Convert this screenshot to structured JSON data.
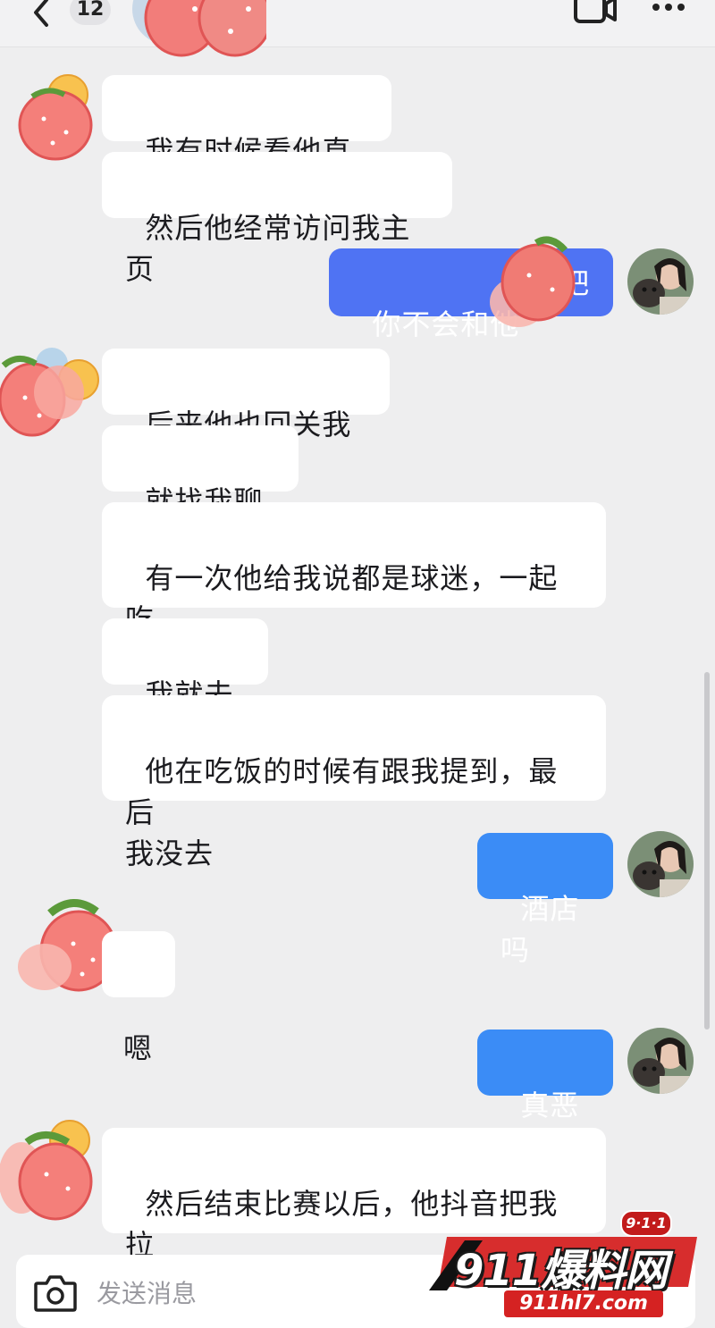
{
  "header": {
    "unread_count": "12",
    "icons": [
      "back-arrow-icon",
      "video-call-icon",
      "more-icon"
    ]
  },
  "messages": [
    {
      "side": "other",
      "text": "我有时候看他直播"
    },
    {
      "side": "other",
      "text": "然后他经常访问我主页"
    },
    {
      "side": "me",
      "text": "你不会和他",
      "text_after": "吧"
    },
    {
      "side": "other",
      "text": "后来他也回关我了"
    },
    {
      "side": "other",
      "text": "就找我聊天"
    },
    {
      "side": "other",
      "text": "有一次他给我说都是球迷，一起吃\n个饭吧"
    },
    {
      "side": "other",
      "text": "我就去了"
    },
    {
      "side": "other",
      "text": "他在吃饭的时候有跟我提到，最后\n我没去"
    },
    {
      "side": "me",
      "text": "酒店吗"
    },
    {
      "side": "other",
      "text": "嗯"
    },
    {
      "side": "me",
      "text": "真恶心"
    },
    {
      "side": "other",
      "text": "然后结束比赛以后，他抖音把我拉\n黑了"
    }
  ],
  "composer": {
    "placeholder": "发送消息",
    "icon": "camera-icon"
  },
  "watermark": {
    "badge": "9·1·1",
    "main": "911爆料网",
    "url": "911hl7.com"
  },
  "colors": {
    "background": "#eeeeef",
    "bubble_other": "#ffffff",
    "bubble_mine": "#3b8cf6",
    "watermark_red": "#d52222"
  }
}
